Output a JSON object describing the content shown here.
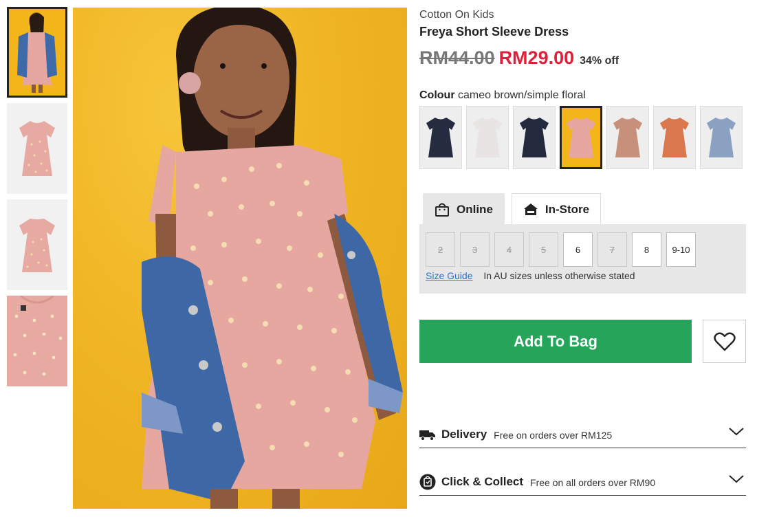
{
  "product": {
    "brand": "Cotton On Kids",
    "title": "Freya Short Sleeve Dress",
    "price_old": "RM44.00",
    "price_new": "RM29.00",
    "discount": "34% off"
  },
  "colour": {
    "label": "Colour",
    "selected_value": "cameo brown/simple floral",
    "swatch_colors": [
      "#252c3f",
      "#e8e4e4",
      "#232a3e",
      "#e7a6a0",
      "#c6907a",
      "#d9774f",
      "#8aa1c1"
    ],
    "selected_index": 3
  },
  "availability_tabs": [
    {
      "label": "Online",
      "icon": "bag-icon"
    },
    {
      "label": "In-Store",
      "icon": "store-icon"
    }
  ],
  "sizes": [
    {
      "label": "2",
      "available": false
    },
    {
      "label": "3",
      "available": false
    },
    {
      "label": "4",
      "available": false
    },
    {
      "label": "5",
      "available": false
    },
    {
      "label": "6",
      "available": true
    },
    {
      "label": "7",
      "available": false
    },
    {
      "label": "8",
      "available": true
    },
    {
      "label": "9-10",
      "available": true
    }
  ],
  "size_guide": {
    "link": "Size Guide",
    "note": "In AU sizes unless otherwise stated"
  },
  "actions": {
    "add_to_bag": "Add To Bag"
  },
  "accordions": {
    "delivery": {
      "title": "Delivery",
      "subtitle": "Free on orders over RM125",
      "icon": "truck-icon"
    },
    "collect": {
      "title": "Click & Collect",
      "subtitle": "Free on all orders over RM90",
      "icon": "collect-icon"
    }
  },
  "colors": {
    "accent_green": "#26a55a",
    "sale_red": "#e0203a",
    "dress_pink": "#e7a6a0",
    "background_yellow": "#f0b524"
  }
}
